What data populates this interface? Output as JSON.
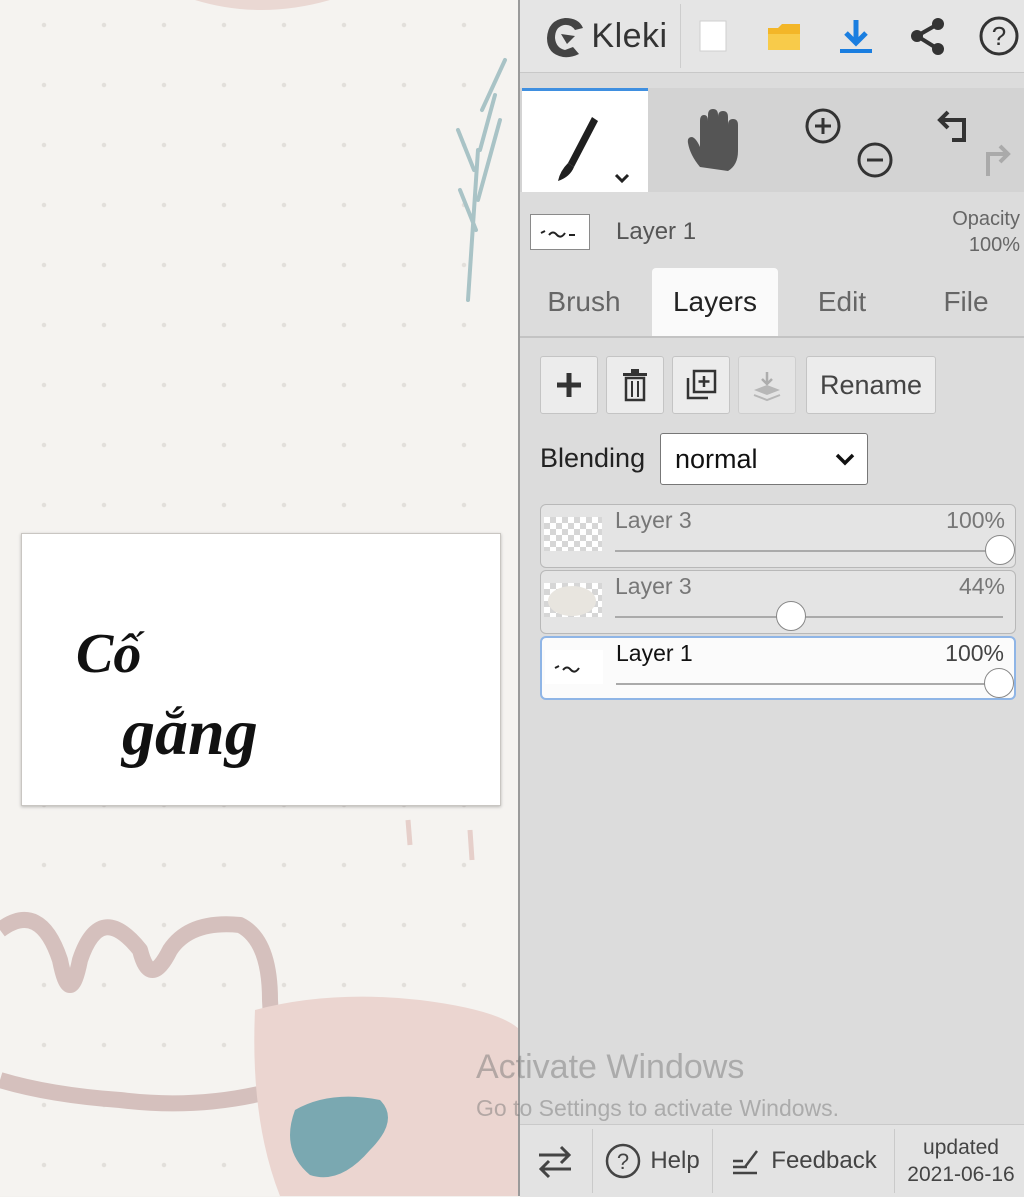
{
  "app": {
    "name": "Kleki"
  },
  "canvas": {
    "text_line1": "Cố",
    "text_line2": "gắng"
  },
  "toolbar": {
    "new_icon": "new-file-icon",
    "open_icon": "folder-open-icon",
    "download_icon": "download-icon",
    "share_icon": "share-icon",
    "help_icon": "help-circle-icon"
  },
  "tools": {
    "brush_icon": "brush-icon",
    "hand_icon": "hand-icon",
    "zoom_in_icon": "zoom-in-icon",
    "zoom_out_icon": "zoom-out-icon",
    "undo_icon": "undo-icon",
    "redo_icon": "redo-icon"
  },
  "current_layer": {
    "name": "Layer 1",
    "opacity_label": "Opacity",
    "opacity_value": "100%"
  },
  "tabs": [
    {
      "label": "Brush",
      "active": false
    },
    {
      "label": "Layers",
      "active": true
    },
    {
      "label": "Edit",
      "active": false
    },
    {
      "label": "File",
      "active": false
    }
  ],
  "layer_buttons": {
    "rename": "Rename"
  },
  "blending": {
    "label": "Blending",
    "value": "normal"
  },
  "layers": [
    {
      "name": "Layer 3",
      "opacity": "100%",
      "value": 1.0,
      "selected": false
    },
    {
      "name": "Layer 3",
      "opacity": "44%",
      "value": 0.44,
      "selected": false
    },
    {
      "name": "Layer 1",
      "opacity": "100%",
      "value": 1.0,
      "selected": true
    }
  ],
  "watermark": {
    "line1": "Activate Windows",
    "line2": "Go to Settings to activate Windows."
  },
  "bottom": {
    "help": "Help",
    "feedback": "Feedback",
    "updated_label": "updated",
    "updated_date": "2021-06-16"
  },
  "colors": {
    "accent": "#3f8fe0",
    "download": "#1a7ee0",
    "folder": "#f3b628"
  }
}
